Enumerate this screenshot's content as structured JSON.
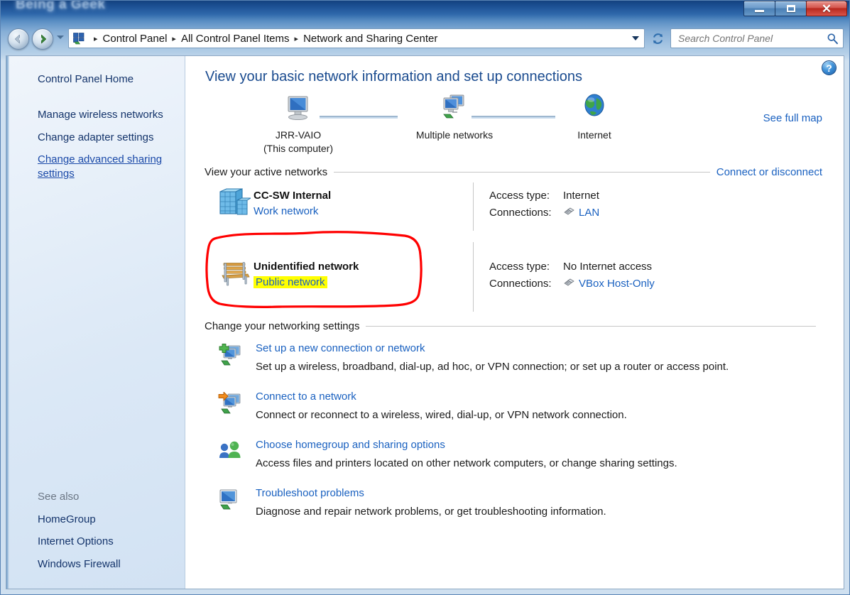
{
  "window": {
    "title": "Being a Geek",
    "controls": {
      "minimize": "Minimize",
      "maximize": "Maximize",
      "close": "Close"
    }
  },
  "nav": {
    "back_label": "Back",
    "forward_label": "Forward",
    "recent_pages_label": "Recent pages",
    "refresh_label": "Refresh",
    "breadcrumb": [
      "Control Panel",
      "All Control Panel Items",
      "Network and Sharing Center"
    ],
    "separator": "▸",
    "previous_locations_label": "Previous locations"
  },
  "search": {
    "placeholder": "Search Control Panel",
    "value": "",
    "icon": "search-icon"
  },
  "help": {
    "glyph": "?",
    "label": "Help"
  },
  "sidebar": {
    "home": "Control Panel Home",
    "items": [
      {
        "label": "Manage wireless networks",
        "active": false
      },
      {
        "label": "Change adapter settings",
        "active": false
      },
      {
        "label": "Change advanced sharing settings",
        "active": true
      }
    ],
    "see_also_heading": "See also",
    "see_also": [
      "HomeGroup",
      "Internet Options",
      "Windows Firewall"
    ]
  },
  "main": {
    "page_title": "View your basic network information and set up connections",
    "see_full_map": "See full map",
    "map": {
      "computer_name": "JRR-VAIO",
      "computer_sub": "(This computer)",
      "middle_label": "Multiple networks",
      "internet_label": "Internet"
    },
    "active_networks": {
      "heading": "View your active networks",
      "action_link": "Connect or disconnect",
      "access_type_label": "Access type:",
      "connections_label": "Connections:",
      "rows": [
        {
          "icon": "office-buildings-icon",
          "name": "CC-SW Internal",
          "type": "Work network",
          "highlighted": false,
          "access_type": "Internet",
          "connection": "LAN",
          "annotated": false
        },
        {
          "icon": "park-bench-icon",
          "name": "Unidentified network",
          "type": "Public network",
          "highlighted": true,
          "access_type": "No Internet access",
          "connection": "VBox Host-Only",
          "annotated": true
        }
      ]
    },
    "settings": {
      "heading": "Change your networking settings",
      "tasks": [
        {
          "icon": "new-connection-icon",
          "link": "Set up a new connection or network",
          "desc": "Set up a wireless, broadband, dial-up, ad hoc, or VPN connection; or set up a router or access point."
        },
        {
          "icon": "connect-network-icon",
          "link": "Connect to a network",
          "desc": "Connect or reconnect to a wireless, wired, dial-up, or VPN network connection."
        },
        {
          "icon": "homegroup-icon",
          "link": "Choose homegroup and sharing options",
          "desc": "Access files and printers located on other network computers, or change sharing settings."
        },
        {
          "icon": "troubleshoot-icon",
          "link": "Troubleshoot problems",
          "desc": "Diagnose and repair network problems, or get troubleshooting information."
        }
      ]
    }
  },
  "annotation": {
    "highlight_color": "#ffff00",
    "circle_color": "#ff0000",
    "target": "Public network"
  },
  "colors": {
    "link": "#1a61c0",
    "title": "#1a4b8f",
    "sidebar_text": "#14346b"
  }
}
